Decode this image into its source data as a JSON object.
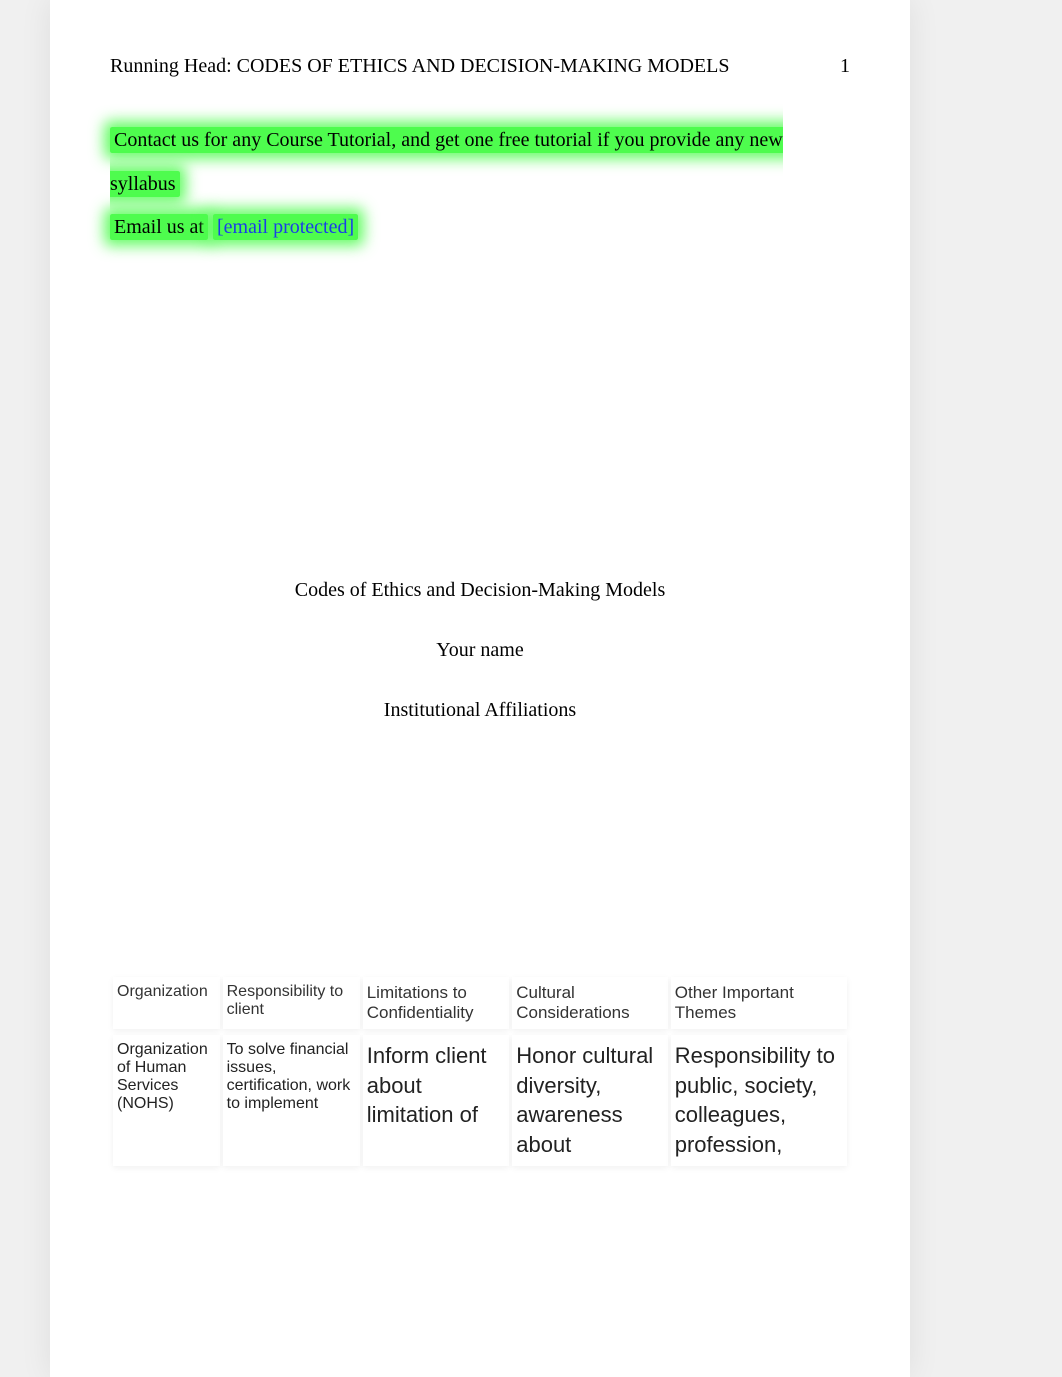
{
  "header": {
    "running_head": "Running Head: CODES OF ETHICS AND DECISION-MAKING MODELS",
    "page_number": "1"
  },
  "promo": {
    "line1": "Contact us for any Course Tutorial, and get one free tutorial if you provide any new syllabus",
    "email_prefix": "Email us at",
    "email_text": "[email protected]"
  },
  "title_block": {
    "title": "Codes of Ethics and Decision-Making Models",
    "author": "Your name",
    "affiliation": "Institutional Affiliations"
  },
  "table": {
    "headers": [
      "Organization",
      "Responsibility to client",
      "Limitations to Confidentiality",
      "Cultural Considerations",
      "Other Important Themes"
    ],
    "rows": [
      {
        "org": "Organization of Human Services (NOHS)",
        "responsibility": "To solve financial issues, certification, work to implement",
        "limitations": "Inform client about limitation of",
        "cultural": "Honor cultural diversity, awareness about",
        "themes": "Responsibility to public, society, colleagues, profession,"
      }
    ]
  }
}
